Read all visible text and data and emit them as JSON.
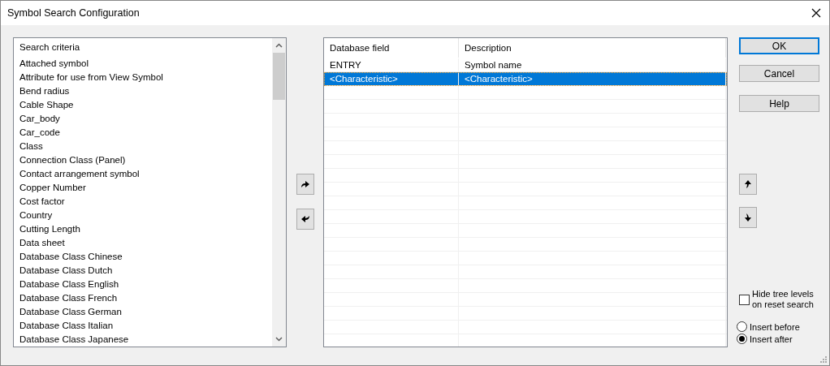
{
  "window": {
    "title": "Symbol Search Configuration"
  },
  "criteria": {
    "header": "Search criteria",
    "items": [
      {
        "label": "Attached symbol",
        "selected": false
      },
      {
        "label": "Attribute for use from View Symbol",
        "selected": false
      },
      {
        "label": "Bend radius",
        "selected": false
      },
      {
        "label": "Cable Shape",
        "selected": false
      },
      {
        "label": "Car_body",
        "selected": false
      },
      {
        "label": "Car_code",
        "selected": false
      },
      {
        "label": "Class",
        "selected": false
      },
      {
        "label": "Connection Class (Panel)",
        "selected": false
      },
      {
        "label": "Contact arrangement symbol",
        "selected": false
      },
      {
        "label": "Copper Number",
        "selected": false
      },
      {
        "label": "Cost factor",
        "selected": false
      },
      {
        "label": "Country",
        "selected": false
      },
      {
        "label": "Cutting Length",
        "selected": false
      },
      {
        "label": "Data sheet",
        "selected": false
      },
      {
        "label": "Database Class Chinese",
        "selected": false
      },
      {
        "label": "Database Class Dutch",
        "selected": false
      },
      {
        "label": "Database Class English",
        "selected": false
      },
      {
        "label": "Database Class French",
        "selected": false
      },
      {
        "label": "Database Class German",
        "selected": false
      },
      {
        "label": "Database Class Italian",
        "selected": false
      },
      {
        "label": "Database Class Japanese",
        "selected": false
      }
    ]
  },
  "table": {
    "columns": [
      "Database field",
      "Description"
    ],
    "rows": [
      {
        "cells": [
          "ENTRY",
          "Symbol name"
        ],
        "selected": false
      },
      {
        "cells": [
          "<Characteristic>",
          "<Characteristic>"
        ],
        "selected": true
      }
    ]
  },
  "buttons": [
    {
      "label": "OK",
      "default": true
    },
    {
      "label": "Cancel",
      "default": false
    },
    {
      "label": "Help",
      "default": false
    }
  ],
  "hide_tree_levels": {
    "label": "Hide tree levels on reset search",
    "checked": false
  },
  "insert_options": [
    {
      "label": "Insert before",
      "selected": false
    },
    {
      "label": "Insert after",
      "selected": true
    }
  ]
}
